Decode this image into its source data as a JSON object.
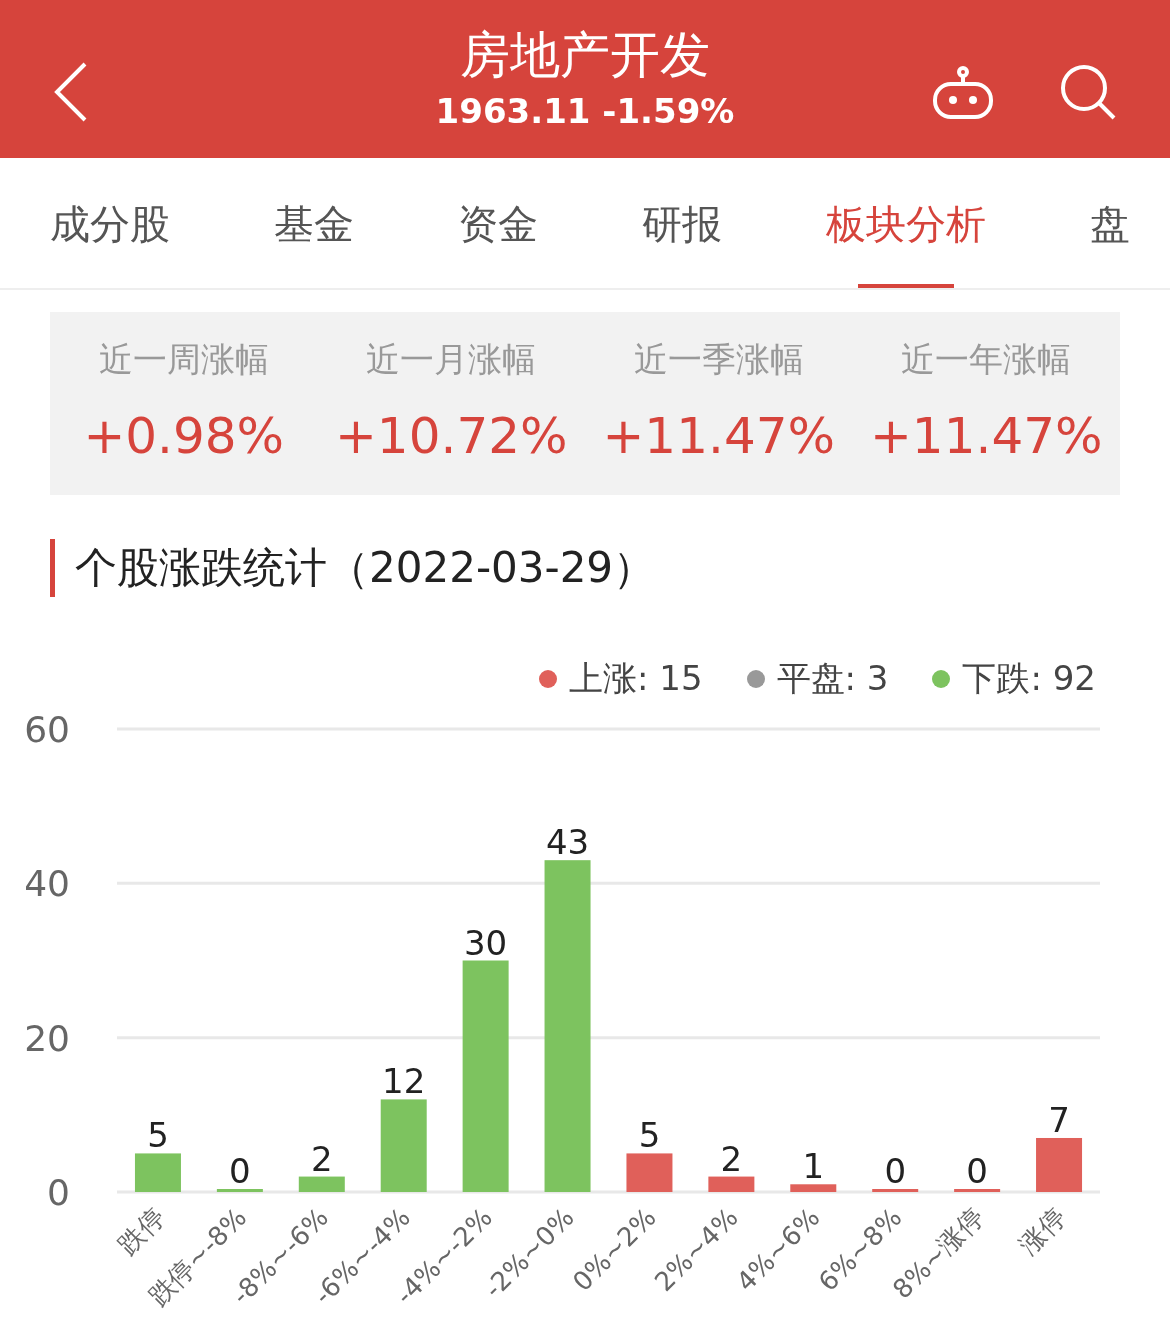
{
  "header": {
    "title": "房地产开发",
    "subtitle": "1963.11 -1.59%"
  },
  "tabs": [
    {
      "label": "成分股",
      "selected": false
    },
    {
      "label": "基金",
      "selected": false
    },
    {
      "label": "资金",
      "selected": false
    },
    {
      "label": "研报",
      "selected": false
    },
    {
      "label": "板块分析",
      "selected": true
    },
    {
      "label": "盘",
      "selected": false
    }
  ],
  "performance": [
    {
      "label": "近一周涨幅",
      "value": "+0.98%"
    },
    {
      "label": "近一月涨幅",
      "value": "+10.72%"
    },
    {
      "label": "近一季涨幅",
      "value": "+11.47%"
    },
    {
      "label": "近一年涨幅",
      "value": "+11.47%"
    }
  ],
  "section_title": "个股涨跌统计（2022-03-29）",
  "legend": [
    {
      "label": "上涨: 15",
      "color": "#e0605a"
    },
    {
      "label": "平盘: 3",
      "color": "#999999"
    },
    {
      "label": "下跌: 92",
      "color": "#7dc35f"
    }
  ],
  "chart_data": {
    "type": "bar",
    "categories": [
      "跌停",
      "跌停~-8%",
      "-8%~-6%",
      "-6%~-4%",
      "-4%~-2%",
      "-2%~0%",
      "0%~2%",
      "2%~4%",
      "4%~6%",
      "6%~8%",
      "8%~涨停",
      "涨停"
    ],
    "series": [
      {
        "color": "#7dc35f",
        "values": [
          5,
          0,
          2,
          12,
          30,
          43,
          null,
          null,
          null,
          null,
          null,
          null
        ]
      },
      {
        "color": "#e0605a",
        "values": [
          null,
          null,
          null,
          null,
          null,
          null,
          5,
          2,
          1,
          0,
          0,
          7
        ]
      }
    ],
    "ylim": [
      0,
      60
    ],
    "yticks": [
      0,
      20,
      40,
      60
    ],
    "data_labels": true
  }
}
